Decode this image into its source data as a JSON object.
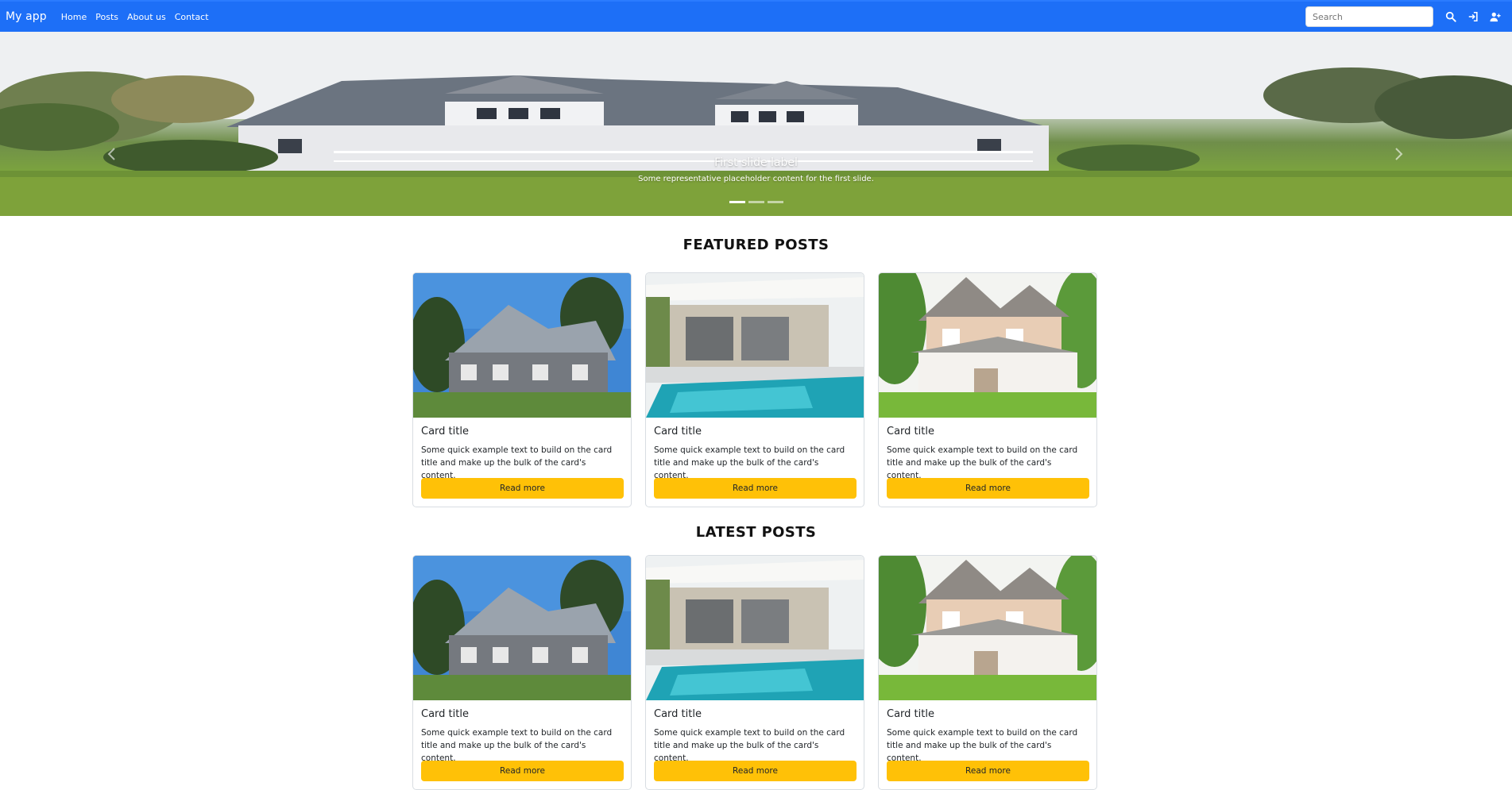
{
  "navbar": {
    "brand": "My app",
    "links": [
      "Home",
      "Posts",
      "About us",
      "Contact"
    ],
    "search_placeholder": "Search",
    "icons": [
      "search-icon",
      "login-icon",
      "user-plus-icon"
    ],
    "color": "#1d6ff7"
  },
  "carousel": {
    "slide_title": "First slide label",
    "slide_text": "Some representative placeholder content for the first slide.",
    "slide_count": 3,
    "active_index": 0
  },
  "featured": {
    "heading": "FEATURED POSTS",
    "cards": [
      {
        "title": "Card title",
        "text": "Some quick example text to build on the card title and make up the bulk of the card's content.",
        "button": "Read more"
      },
      {
        "title": "Card title",
        "text": "Some quick example text to build on the card title and make up the bulk of the card's content.",
        "button": "Read more"
      },
      {
        "title": "Card title",
        "text": "Some quick example text to build on the card title and make up the bulk of the card's content.",
        "button": "Read more"
      }
    ]
  },
  "latest": {
    "heading": "LATEST POSTS",
    "cards": [
      {
        "title": "Card title",
        "text": "Some quick example text to build on the card title and make up the bulk of the card's content.",
        "button": "Read more"
      },
      {
        "title": "Card title",
        "text": "Some quick example text to build on the card title and make up the bulk of the card's content.",
        "button": "Read more"
      },
      {
        "title": "Card title",
        "text": "Some quick example text to build on the card title and make up the bulk of the card's content.",
        "button": "Read more"
      }
    ]
  },
  "colors": {
    "button": "#ffc107",
    "nav": "#1d6ff7"
  }
}
